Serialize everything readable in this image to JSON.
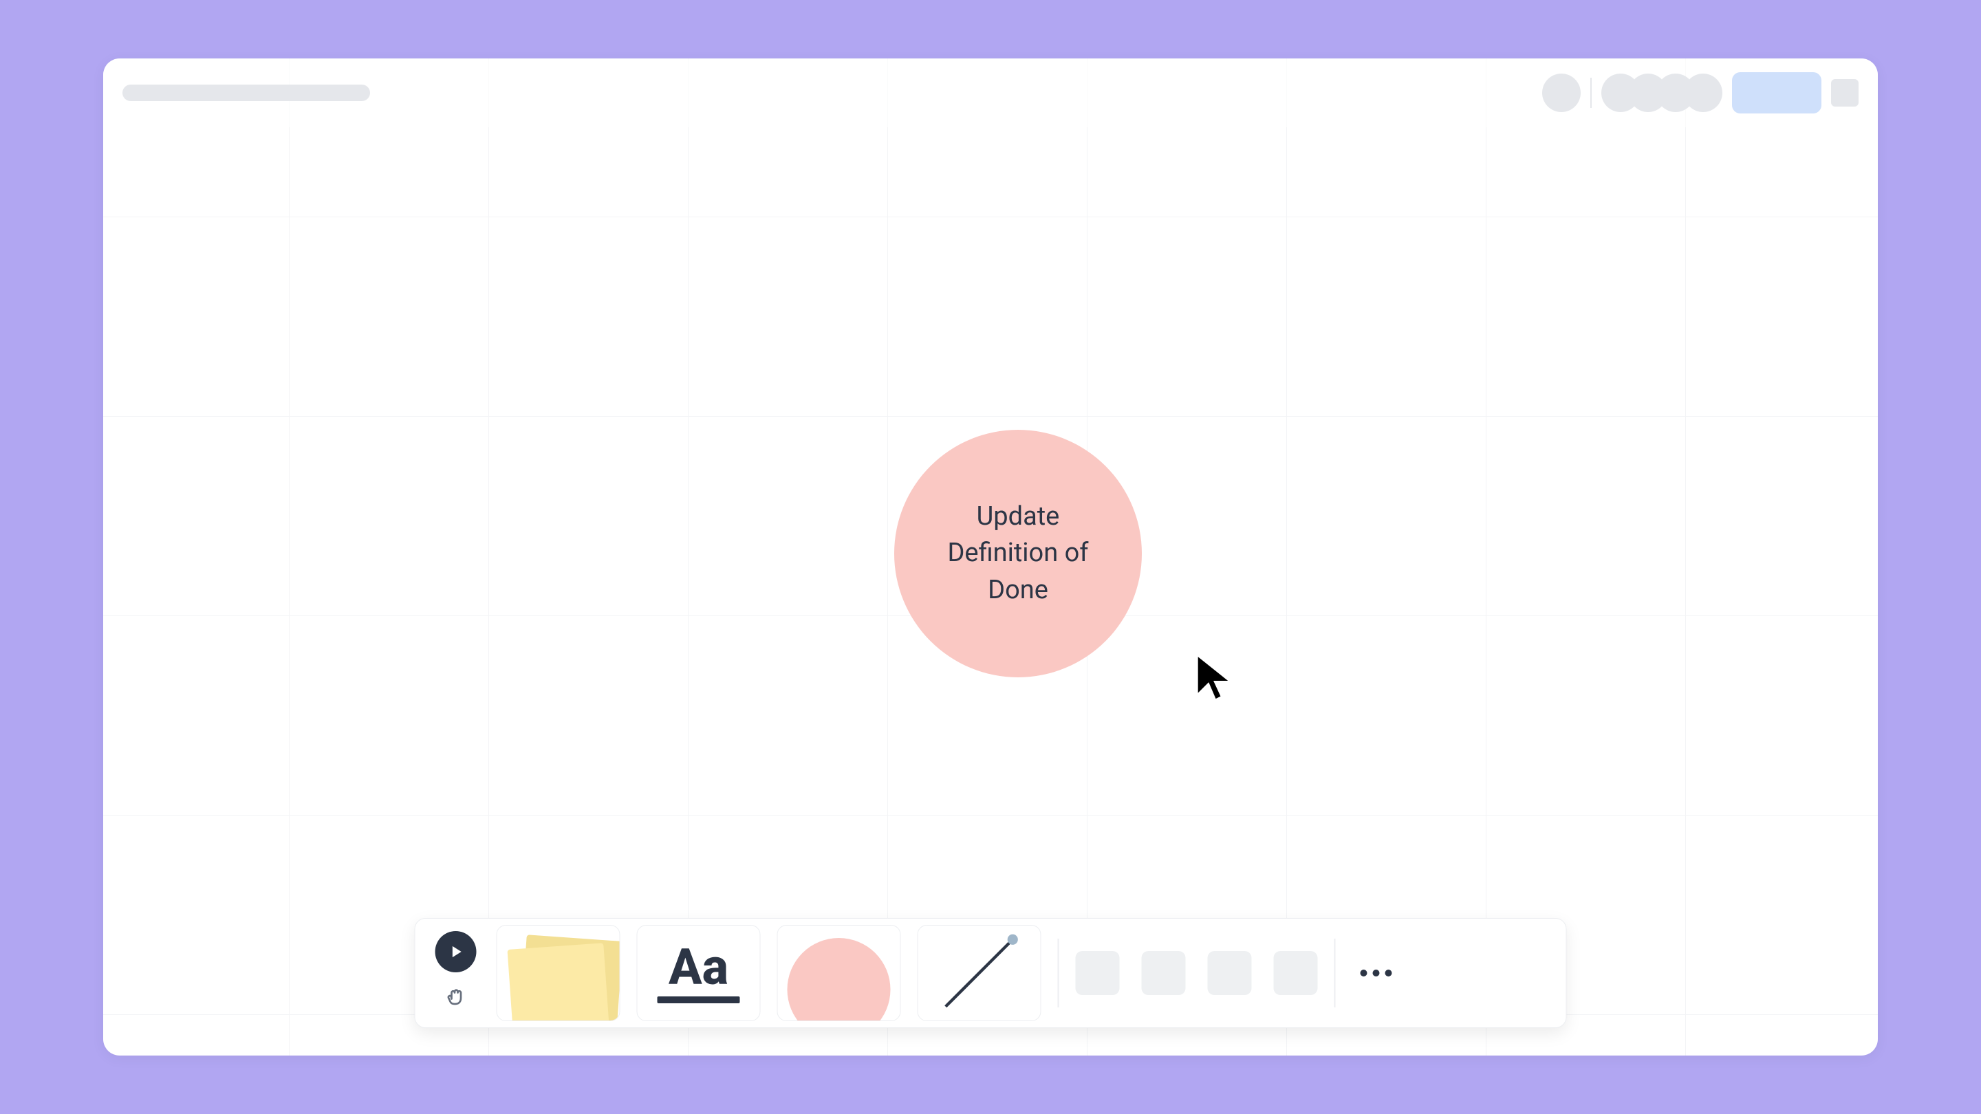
{
  "canvas": {
    "circle_text": "Update Definition of Done"
  },
  "toolbar": {
    "sticky_name": "sticky-note-tool",
    "text_name": "text-tool",
    "shape_name": "shape-tool",
    "connector_name": "connector-tool",
    "text_glyph": "Aa"
  },
  "colors": {
    "accent_bg": "#b1a6f2",
    "shape_fill": "#fac8c3",
    "sticky_front": "#fceaa6",
    "sticky_back": "#f3df93",
    "share_button": "#cfe0fb",
    "ink": "#2c3545"
  }
}
